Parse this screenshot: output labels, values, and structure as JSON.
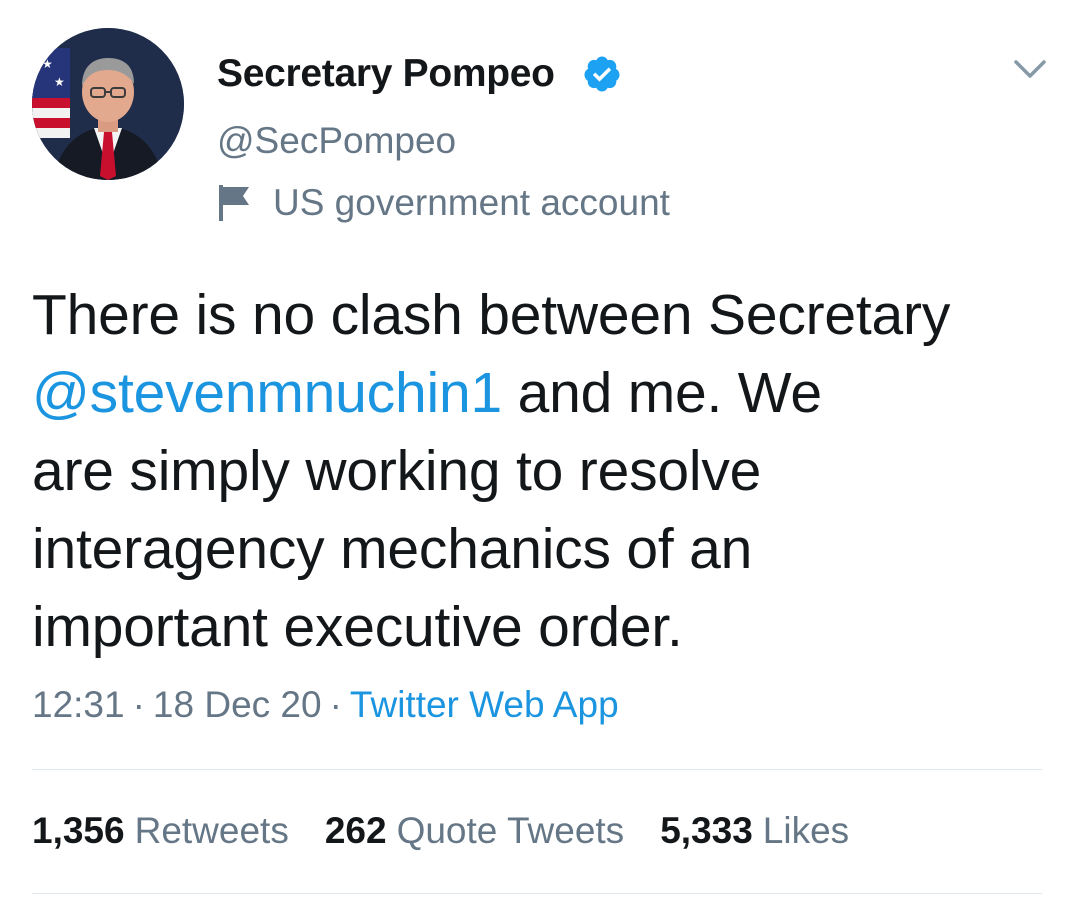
{
  "author": {
    "display_name": "Secretary Pompeo",
    "handle": "@SecPompeo",
    "label": "US government account",
    "verified": true
  },
  "tweet": {
    "lines": [
      {
        "before": "There is no clash between Secretary",
        "mention": "",
        "after": ""
      },
      {
        "before": "",
        "mention": "@stevenmnuchin1",
        "after": " and me. We"
      },
      {
        "before": "are simply working to resolve",
        "mention": "",
        "after": ""
      },
      {
        "before": "interagency mechanics of an",
        "mention": "",
        "after": ""
      },
      {
        "before": "important executive order.",
        "mention": "",
        "after": ""
      }
    ]
  },
  "meta": {
    "time": "12:31",
    "date": "18 Dec 20",
    "separator": "·",
    "source": "Twitter Web App"
  },
  "stats": {
    "retweets_count": "1,356",
    "retweets_label": "Retweets",
    "quote_tweets_count": "262",
    "quote_tweets_label": "Quote Tweets",
    "likes_count": "5,333",
    "likes_label": "Likes"
  },
  "icons": {
    "verified": "verified-badge-icon",
    "flag": "flag-icon",
    "menu": "chevron-down-icon"
  },
  "colors": {
    "link": "#1b95e0",
    "secondary_text": "#657786",
    "primary_text": "#14171a",
    "verified": "#1da1f2"
  }
}
